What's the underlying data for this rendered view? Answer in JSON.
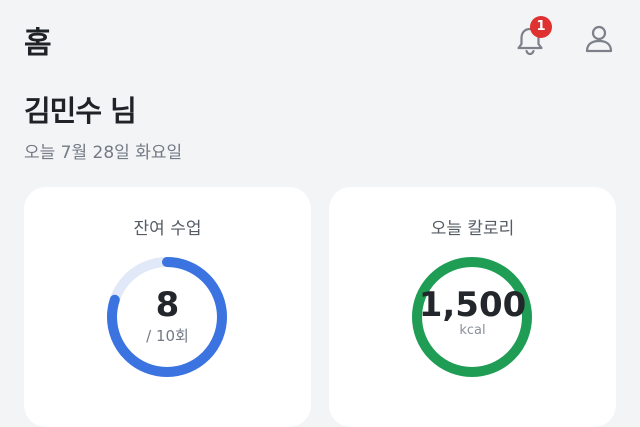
{
  "header": {
    "title": "홈",
    "notifications": {
      "icon": "bell-icon",
      "badge_count": "1"
    },
    "profile_icon": "user-icon"
  },
  "greeting": {
    "name": "김민수 님",
    "date": "오늘 7월 28일 화요일"
  },
  "cards": {
    "remaining_classes": {
      "title": "잔여 수업",
      "value": "8",
      "total_label": "/ 10회",
      "progress": 0.8,
      "color": "#3b73e0",
      "track_color": "#e1e8f8"
    },
    "calories": {
      "title": "오늘 칼로리",
      "value": "1,500",
      "unit": "kcal",
      "progress": 1.0,
      "color": "#1f9d55",
      "track_color": "#d8f0e2"
    }
  },
  "colors": {
    "background": "#f3f4f6",
    "badge": "#e03131"
  }
}
